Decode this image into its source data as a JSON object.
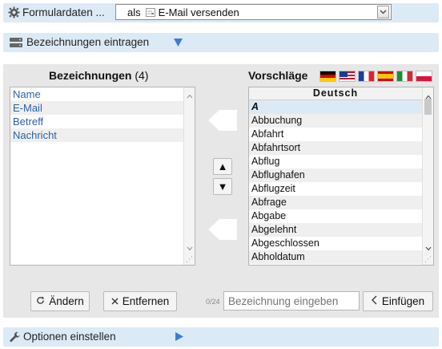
{
  "top_bar": {
    "title": "Formulardaten ...",
    "select_prefix": "als",
    "select_value": "E-Mail versenden"
  },
  "section_bezeichnungen": {
    "label": "Bezeichnungen eintragen"
  },
  "left_panel": {
    "heading": "Bezeichnungen",
    "count": "(4)",
    "items": [
      "Name",
      "E-Mail",
      "Betreff",
      "Nachricht"
    ]
  },
  "right_panel": {
    "heading": "Vorschläge",
    "column_header": "Deutsch",
    "items": [
      "A",
      "Abbuchung",
      "Abfahrt",
      "Abfahrtsort",
      "Abflug",
      "Abflughafen",
      "Abflugzeit",
      "Abfrage",
      "Abgabe",
      "Abgelehnt",
      "Abgeschlossen",
      "Abholdatum"
    ],
    "flags": [
      "german-flag",
      "usa-uk-flag",
      "french-flag",
      "spanish-flag",
      "italian-flag",
      "polish-flag"
    ]
  },
  "move_buttons": {
    "up": "▲",
    "down": "▼"
  },
  "actions": {
    "change_label": "Ändern",
    "remove_label": "Entfernen",
    "char_counter": "0/24",
    "input_placeholder": "Bezeichnung eingeben",
    "insert_label": "Einfügen"
  },
  "section_options": {
    "label": "Optionen einstellen"
  },
  "colors": {
    "bar_bg": "#dceaf6",
    "panel_bg": "#e7e7e7",
    "link_blue": "#2a62a8",
    "triangle_blue": "#3b7fd0"
  }
}
